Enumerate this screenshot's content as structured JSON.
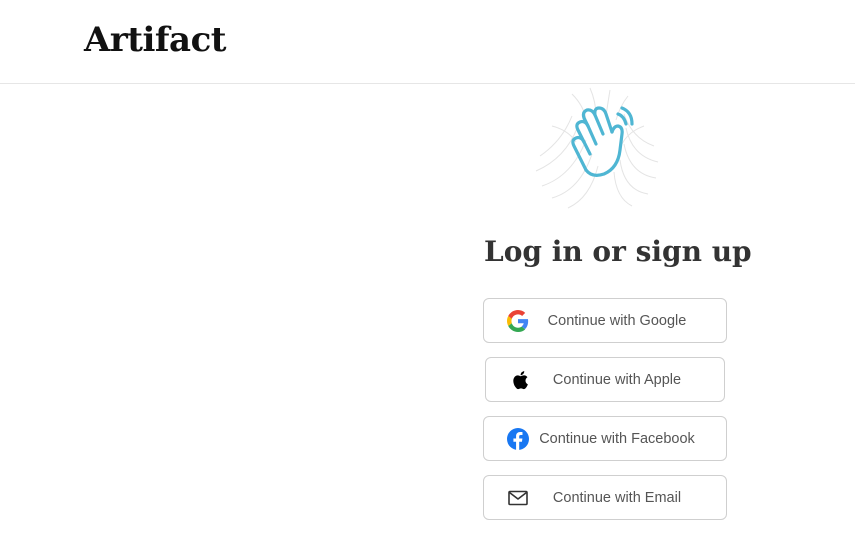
{
  "header": {
    "logo_text": "Artifact"
  },
  "main": {
    "heading": "Log in or sign up",
    "buttons": [
      {
        "label": "Continue with Google",
        "icon": "google-icon"
      },
      {
        "label": "Continue with Apple",
        "icon": "apple-icon"
      },
      {
        "label": "Continue with Facebook",
        "icon": "facebook-icon"
      },
      {
        "label": "Continue with Email",
        "icon": "mail-icon"
      }
    ]
  },
  "colors": {
    "hand_accent": "#4fb6d3",
    "facebook_blue": "#1877f2",
    "border": "#cfcfcf",
    "divider": "#e6e6e6"
  }
}
